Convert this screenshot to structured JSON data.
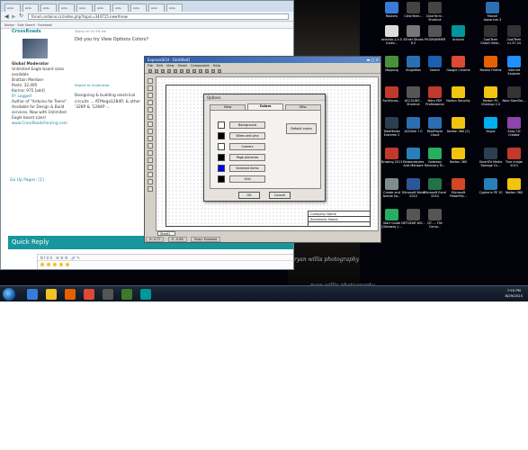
{
  "browser": {
    "tabs": [
      "Ardu",
      "Ardu",
      "Ardu",
      "Ardu",
      "Ardu",
      "Ardu",
      "Ardu",
      "Ardu",
      "Ardu",
      "Ardu"
    ],
    "url": "forum.arduino.cc/index.php?topic=344715.new#new",
    "bookmarks": "Norton  ·  Safe Search  ·  Facebook",
    "profile": {
      "name": "CrossRoads",
      "rank": "Global Moderator",
      "title": "Unlimited Eagle board sizes available",
      "member": "Brattain Member",
      "posts": "Posts: 32,495",
      "karma": "Karma: 975  [add]",
      "ip": "IP: Logged",
      "bio": "Author of \"Arduino for Teens\". Available for Design & Build services. Now with Unlimited Eagle board sizes!",
      "site": "www.CrossRoadsFencing.com"
    },
    "post": {
      "date": "Today at 01:56 am",
      "question": "Did you try View Options Colors?",
      "report": "Report to moderator",
      "sig": "Designing & building electrical circuits ... ATMega1284P, & other '328P & '1284P ..."
    },
    "nav": "Go Up   Pages: [1]",
    "quick_reply": "Quick Reply"
  },
  "sch": {
    "title": "ExpressSCH - [Untitled]",
    "menu": [
      "File",
      "Edit",
      "View",
      "Sheet",
      "Component",
      "Help"
    ],
    "titleblock": [
      "Company Name",
      "Schematic Name",
      ""
    ],
    "sheet_tab": "Sheet1",
    "status": [
      "X: 0.77",
      "Y: -0.98",
      "Snap: Enabled"
    ]
  },
  "options": {
    "title": "Options",
    "tabs": [
      "View",
      "Colors",
      "Misc"
    ],
    "active_tab": "Colors",
    "rows": [
      {
        "label": "Background",
        "color": "#ffffff"
      },
      {
        "label": "Wires and pins",
        "color": "#000000"
      },
      {
        "label": "Comers",
        "color": "#ffffff"
      },
      {
        "label": "Page pieceries",
        "color": "#000000"
      },
      {
        "label": "Selected items",
        "color": "#0000ff"
      },
      {
        "label": "Grid",
        "color": "#000000"
      }
    ],
    "default_label": "Default colors",
    "ok": "OK",
    "cancel": "Cancel"
  },
  "desktop_icons": [
    {
      "label": "Routers",
      "color": "#3a7bd5"
    },
    {
      "label": "ClearTerm...",
      "color": "#444444"
    },
    {
      "label": "ClearTerm - Shortcut",
      "color": "#444444"
    },
    {
      "label": "Marvel Aquarium 3",
      "color": "#2b6fb0"
    },
    {
      "label": "arduino-1.5.5 tunes...",
      "color": "#dddddd"
    },
    {
      "label": "ATmel Studio 6.2",
      "color": "#777777"
    },
    {
      "label": "PrOGRAMMER",
      "color": "#555555"
    },
    {
      "label": "Arduino",
      "color": "#00979c"
    },
    {
      "label": "CoolTerm Graph View...",
      "color": "#333333"
    },
    {
      "label": "CoolTerm v1.57.24",
      "color": "#333333"
    },
    {
      "label": "Mapping",
      "color": "#4a8f3c"
    },
    {
      "label": "SingleBox",
      "color": "#2b6fb0"
    },
    {
      "label": "Search",
      "color": "#1a5fb0"
    },
    {
      "label": "Google Chrome",
      "color": "#d94a38"
    },
    {
      "label": "Mozilla Firefox",
      "color": "#e66000"
    },
    {
      "label": "Internet Explorer",
      "color": "#1e90ff"
    },
    {
      "label": "Fortifynes...",
      "color": "#c0392b"
    },
    {
      "label": "ACCOUNT... Shortcut",
      "color": "#555555"
    },
    {
      "label": "Nitro PDF Professional",
      "color": "#c0392b"
    },
    {
      "label": "Norton Security",
      "color": "#f1c40f"
    },
    {
      "label": "Norton PC Checkup 2.0",
      "color": "#f1c40f"
    },
    {
      "label": "Nero StartSm...",
      "color": "#333333"
    },
    {
      "label": "TotalMedia Extreme 2",
      "color": "#2c3e50"
    },
    {
      "label": "ACDSee 7.0",
      "color": "#2b6fb0"
    },
    {
      "label": "RealPlayer Cloud",
      "color": "#2b6fb0"
    },
    {
      "label": "Norton 360 (2)",
      "color": "#f1c40f"
    },
    {
      "label": "Skype",
      "color": "#00aff0"
    },
    {
      "label": "Easy CD Creator",
      "color": "#8e44ad"
    },
    {
      "label": "Drawing 2011",
      "color": "#c0392b"
    },
    {
      "label": "Malwarebytes Anti-Malware",
      "color": "#2980b9"
    },
    {
      "label": "Gateway Recovery M...",
      "color": "#27ae60"
    },
    {
      "label": "Norton 360",
      "color": "#f1c40f"
    },
    {
      "label": "SmartFit Media Storage Cu...",
      "color": "#2c3e50"
    },
    {
      "label": "True Image 2013",
      "color": "#c0392b"
    },
    {
      "label": "Create and format ha...",
      "color": "#7f8c8d"
    },
    {
      "label": "Microsoft Word 2010",
      "color": "#2b579a"
    },
    {
      "label": "Microsoft Excel 2010",
      "color": "#217346"
    },
    {
      "label": "Microsoft PowerPoi...",
      "color": "#d24726"
    },
    {
      "label": "Cypherix PE 10",
      "color": "#2980b9"
    },
    {
      "label": "Norton 360",
      "color": "#f1c40f"
    },
    {
      "label": "Start Guide (Gateway L...",
      "color": "#27ae60"
    },
    {
      "label": "NETGEAR WG...",
      "color": "#555555"
    },
    {
      "label": "DT..... File Comp...",
      "color": "#555555"
    }
  ],
  "wallpaper_caption": "ryan willis photography",
  "taskbar": {
    "clock_time": "7:55 PM",
    "clock_date": "8/29/2015",
    "colors": [
      "#3a7bd5",
      "#f3c323",
      "#e66000",
      "#d94a38",
      "#555555",
      "#3c7a2a",
      "#00979c"
    ]
  }
}
